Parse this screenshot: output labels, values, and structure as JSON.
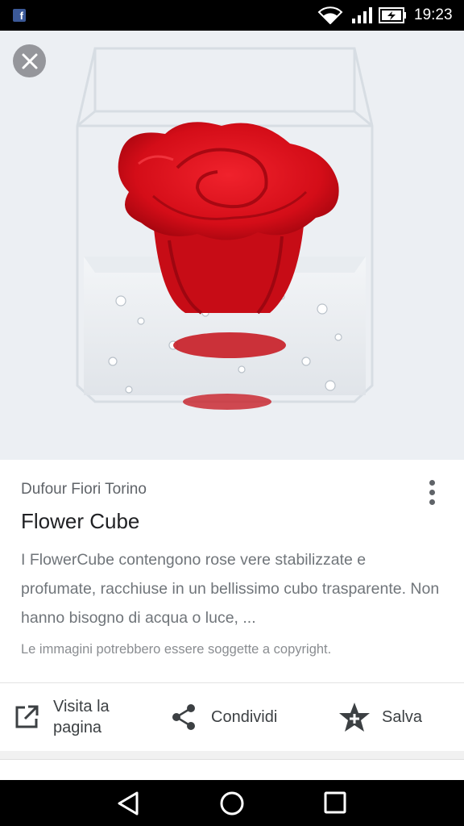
{
  "status_bar": {
    "app_notification_icon": "facebook-icon",
    "time": "19:23",
    "icons": [
      "wifi-icon",
      "signal-icon",
      "battery-charging-icon"
    ]
  },
  "viewer": {
    "image_subject": "red rose in clear acrylic cube",
    "close_icon": "close-icon"
  },
  "result": {
    "source": "Dufour Fiori Torino",
    "title": "Flower Cube",
    "description": "I FlowerCube contengono rose vere stabilizzate e profumate, racchiuse in un bellissimo cubo trasparente. Non hanno bisogno di acqua o luce, ...",
    "copyright_notice": "Le immagini potrebbero essere soggette a copyright.",
    "more_icon": "more-vert-icon"
  },
  "actions": {
    "visit_label": "Visita la pagina",
    "share_label": "Condividi",
    "save_label": "Salva"
  },
  "nav_bar": {
    "buttons": [
      "back-icon",
      "home-icon",
      "recents-icon"
    ]
  },
  "colors": {
    "status_bar_bg": "#000000",
    "image_bg": "#eceff3",
    "rose_red": "#d9101c",
    "text_primary": "#202124",
    "text_secondary": "#70757a"
  }
}
